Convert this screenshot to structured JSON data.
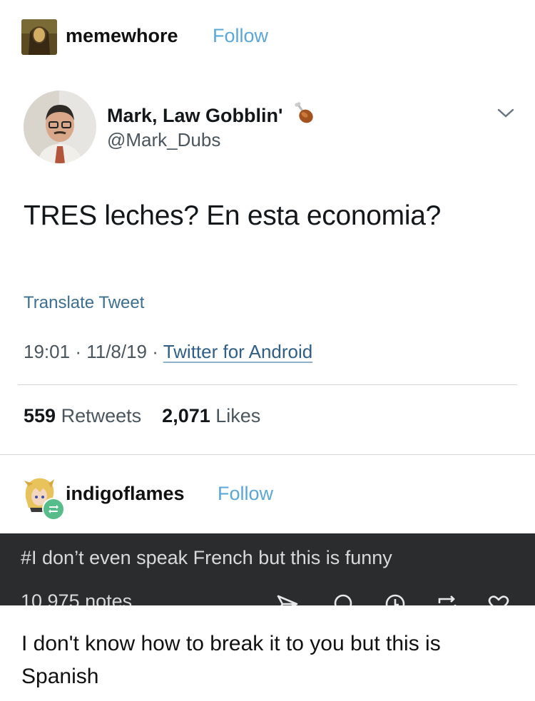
{
  "post": {
    "blog_name": "memewhore",
    "follow_label": "Follow"
  },
  "tweet": {
    "display_name": "Mark, Law Gobblin'",
    "name_emoji": "drumstick-icon",
    "handle": "@Mark_Dubs",
    "text": "TRES leches? En esta economia?",
    "translate_label": "Translate Tweet",
    "time": "19:01",
    "date": "11/8/19",
    "source": "Twitter for Android",
    "retweets_count": "559",
    "retweets_label": "Retweets",
    "likes_count": "2,071",
    "likes_label": "Likes"
  },
  "reblog": {
    "blog_name": "indigoflames",
    "follow_label": "Follow",
    "tag": "#I don’t even speak French but this is funny",
    "notes": "10,975 notes"
  },
  "caption": "I don't know how to break it to you but this is Spanish",
  "colors": {
    "follow": "#5aa7d8",
    "reblog_badge": "#56bc8a",
    "dark_bar": "#2b2c2d",
    "link": "#2f5f86"
  }
}
